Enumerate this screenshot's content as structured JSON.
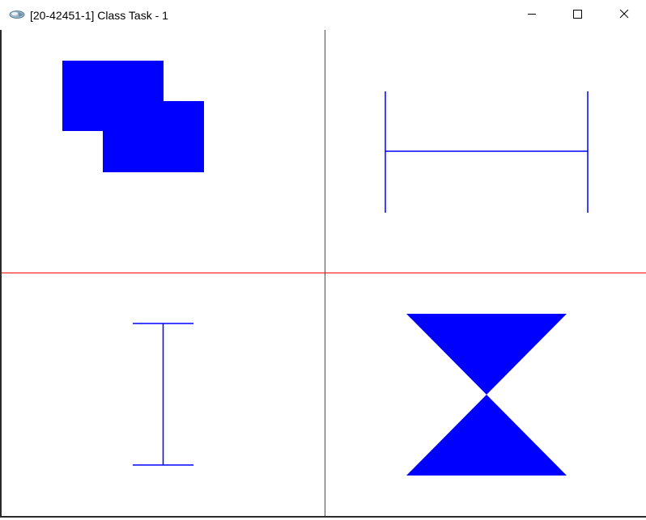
{
  "window": {
    "title": "[20-42451-1] Class Task - 1",
    "icon": "opengl-app-icon"
  },
  "caption_buttons": {
    "minimize_icon": "minimize-icon",
    "maximize_icon": "maximize-icon",
    "close_icon": "close-icon"
  },
  "colors": {
    "axis": "#ff0000",
    "shape": "#0000ff",
    "background": "#ffffff"
  },
  "canvas": {
    "shapes": [
      "two-overlapping-filled-rectangles",
      "horizontal-i-beam-lines",
      "vertical-i-beam-lines",
      "filled-hourglass-triangles"
    ]
  }
}
